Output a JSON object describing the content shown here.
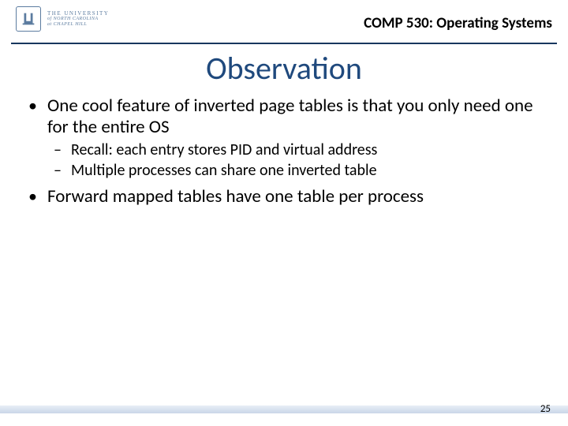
{
  "header": {
    "logo": {
      "institution_line1": "THE UNIVERSITY",
      "institution_line2": "of NORTH CAROLINA",
      "institution_line3": "at CHAPEL HILL"
    },
    "course": "COMP 530: Operating Systems"
  },
  "title": "Observation",
  "bullets": [
    {
      "text": "One cool feature of inverted page tables is that you only need one for the entire OS",
      "sub": [
        "Recall: each entry stores PID and virtual address",
        "Multiple processes can share one inverted table"
      ]
    },
    {
      "text": "Forward mapped tables have one table per process",
      "sub": []
    }
  ],
  "page_number": "25"
}
